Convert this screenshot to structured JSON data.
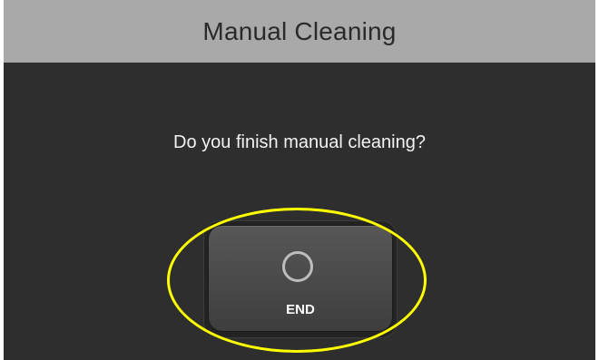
{
  "dialog": {
    "title": "Manual Cleaning",
    "prompt": "Do you finish manual cleaning?"
  },
  "end_button": {
    "label": "END",
    "icon": "circle-icon"
  },
  "colors": {
    "background": "#2e2e2e",
    "titlebar": "#a9a9a9",
    "highlight": "#ffff00"
  }
}
